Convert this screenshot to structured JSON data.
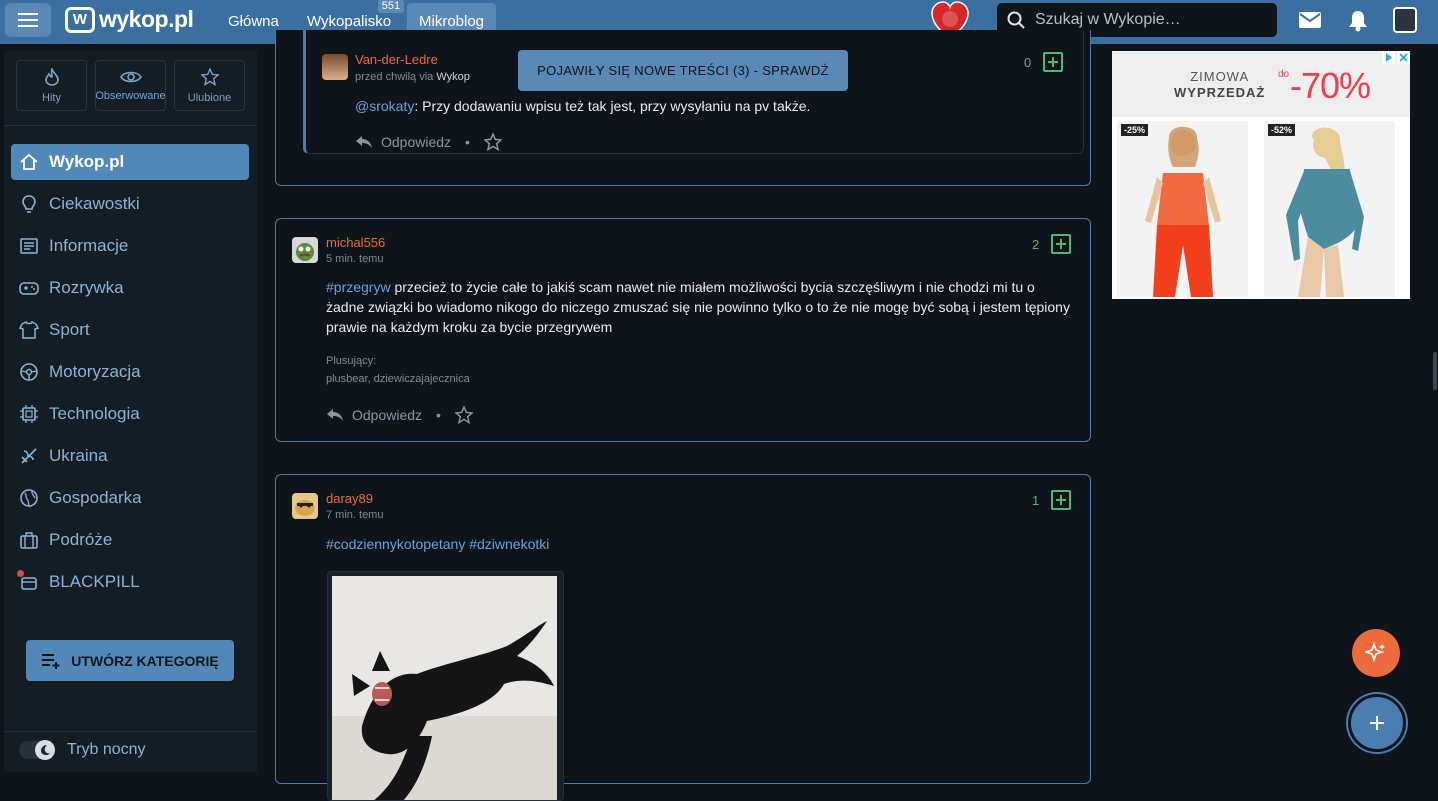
{
  "header": {
    "logo": "wykop.pl",
    "logo_mark": "W",
    "nav": [
      {
        "label": "Główna"
      },
      {
        "label": "Wykopalisko",
        "badge": "551"
      },
      {
        "label": "Mikroblog"
      }
    ],
    "search_placeholder": "Szukaj w Wykopie…",
    "icons": [
      "menu-icon",
      "mail-icon",
      "bell-icon",
      "user-avatar"
    ]
  },
  "sidebar": {
    "quick_tabs": [
      {
        "label": "Hity",
        "icon": "flame-icon"
      },
      {
        "label": "Obserwowane",
        "icon": "eye-icon"
      },
      {
        "label": "Ulubione",
        "icon": "star-icon"
      }
    ],
    "items": [
      {
        "label": "Wykop.pl",
        "icon": "home-icon"
      },
      {
        "label": "Ciekawostki",
        "icon": "lightbulb-icon"
      },
      {
        "label": "Informacje",
        "icon": "newspaper-icon"
      },
      {
        "label": "Rozrywka",
        "icon": "gamepad-icon"
      },
      {
        "label": "Sport",
        "icon": "shirt-icon"
      },
      {
        "label": "Motoryzacja",
        "icon": "steering-wheel-icon"
      },
      {
        "label": "Technologia",
        "icon": "chip-icon"
      },
      {
        "label": "Ukraina",
        "icon": "ukraine-icon"
      },
      {
        "label": "Gospodarka",
        "icon": "globe-icon"
      },
      {
        "label": "Podróże",
        "icon": "suitcase-icon"
      },
      {
        "label": "BLACKPILL",
        "icon": "pill-icon"
      }
    ],
    "create_button": "UTWÓRZ KATEGORIĘ",
    "night_mode": "Tryb nocny"
  },
  "banner": "POJAWIŁY SIĘ NOWE TREŚCI (3) - SPRAWDŹ",
  "entries": [
    {
      "author": "Van-der-Ledre",
      "time": "przed chwilą",
      "via_prefix": "via",
      "via": "Wykop",
      "votes": "0",
      "mention": "@srokaty",
      "text": ": Przy dodawaniu wpisu też tak jest, przy wysyłaniu na pv także.",
      "reply_label": "Odpowiedz"
    },
    {
      "author": "michal556",
      "time": "5 min. temu",
      "votes": "2",
      "tag": "#przegryw",
      "text": " przecież to życie całe to jakiś scam nawet nie miałem możliwości bycia szczęśliwym i nie chodzi mi tu o żadne związki bo wiadomo nikogo do niczego zmuszać się nie powinno tylko o to że nie mogę być sobą i jestem tępiony prawie na każdym kroku za bycie przegrywem",
      "plusers_label": "Plusujący:",
      "plusers": "plusbear, dziewiczajajecznica",
      "reply_label": "Odpowiedz"
    },
    {
      "author": "daray89",
      "time": "7 min. temu",
      "votes": "1",
      "tag1": "#codziennykotopetany",
      "tag2": "#dziwnekotki",
      "image": "black-cat-photo"
    }
  ],
  "ad": {
    "line1": "ZIMOWA",
    "line2": "WYPRZEDAŻ",
    "prefix": "do",
    "discount": "-70%",
    "badge1": "-25%",
    "badge2": "-52%"
  },
  "colors": {
    "topbar": "#3a6f9f",
    "accent": "#5188b8",
    "username": "#e76c32",
    "vote": "#4fb872",
    "background": "#0f141b"
  }
}
